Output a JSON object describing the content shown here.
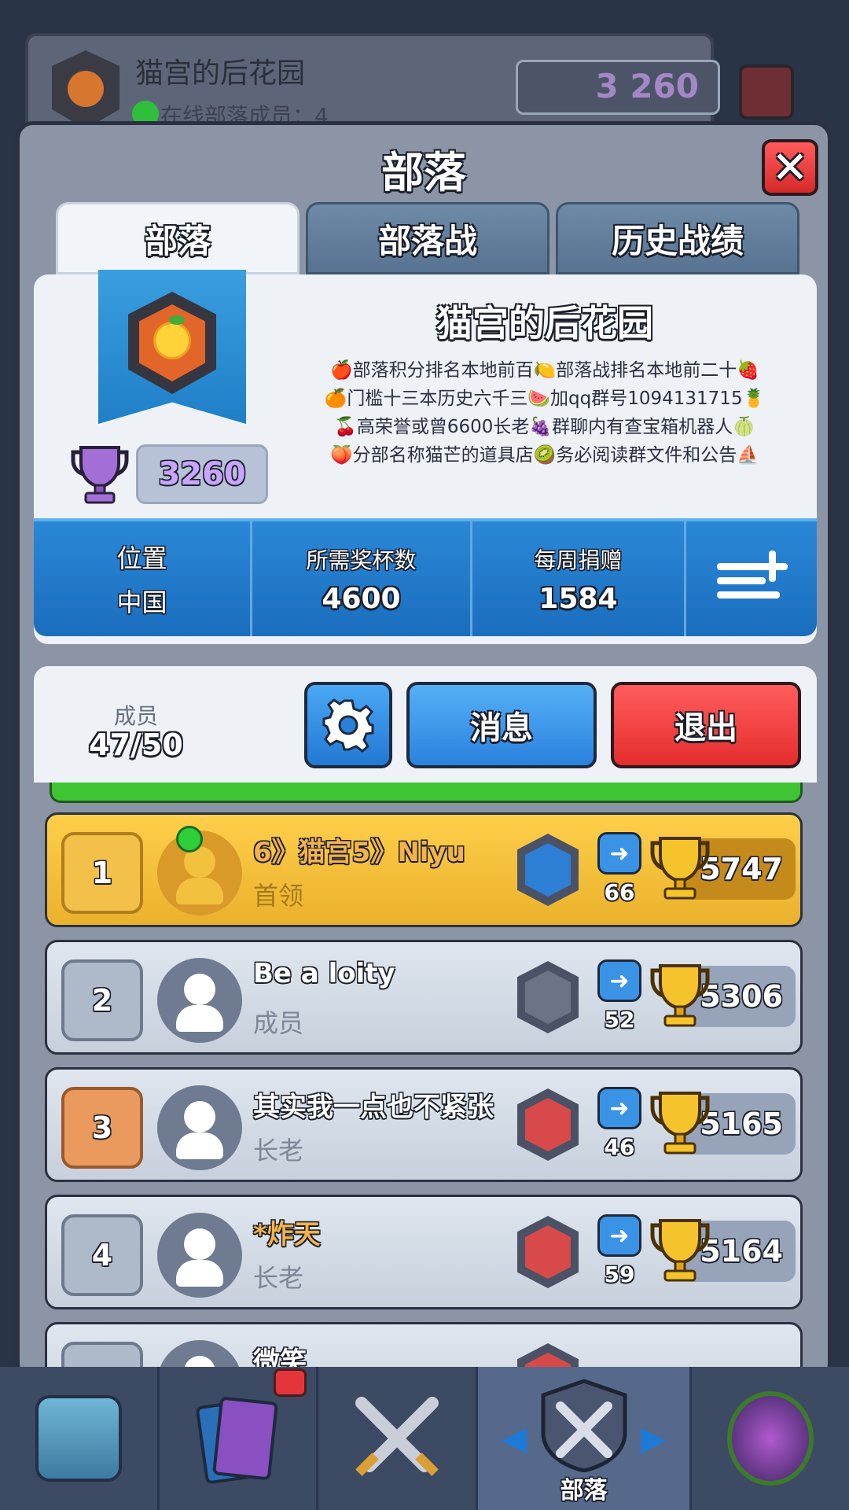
{
  "background": {
    "clan_name": "猫宫的后花园",
    "online_text": "在线部落成员：4",
    "trophies": "3 260"
  },
  "modal": {
    "title": "部落",
    "close_symbol": "✕",
    "tabs": [
      "部落",
      "部落战",
      "历史战绩"
    ],
    "active_tab": 0
  },
  "clan": {
    "name": "猫宫的后花园",
    "trophies": "3260",
    "description": [
      "🍎部落积分排名本地前百🍋部落战排名本地前二十🍓",
      "🍊门槛十三本历史六千三🍉加qq群号1094131715🍍",
      "🍒高荣誉或曾6600长老🍇群聊内有查宝箱机器人🍈",
      "🍑分部名称猫芒的道具店🥝务必阅读群文件和公告⛵"
    ],
    "stats": {
      "location_label": "位置",
      "location_value": "中国",
      "required_label": "所需奖杯数",
      "required_value": "4600",
      "donations_label": "每周捐赠",
      "donations_value": "1584"
    }
  },
  "members_panel": {
    "label": "成员",
    "count": "47/50",
    "message_button": "消息",
    "exit_button": "退出"
  },
  "members": [
    {
      "rank": "1",
      "name": "6》猫宫5》Niyu",
      "role": "首领",
      "donations": "66",
      "trophies": "5747",
      "online": true,
      "arena": "potion"
    },
    {
      "rank": "2",
      "name": "Be a loity",
      "role": "成员",
      "donations": "52",
      "trophies": "5306",
      "online": false,
      "arena": "hammer"
    },
    {
      "rank": "3",
      "name": "其实我一点也不紧张",
      "role": "长老",
      "donations": "46",
      "trophies": "5165",
      "online": false,
      "arena": "target"
    },
    {
      "rank": "4",
      "name": "*炸天",
      "role": "长老",
      "donations": "59",
      "trophies": "5164",
      "online": false,
      "arena": "target"
    },
    {
      "rank": "",
      "name": "微笑",
      "role": "",
      "donations": "",
      "trophies": "",
      "online": false,
      "arena": "target"
    }
  ],
  "bottom_nav": {
    "active_label": "部落",
    "cards_badge": "!"
  },
  "colors": {
    "accent_blue": "#2a88d6",
    "leader_gold": "#f3c04a",
    "exit_red": "#e52d2d",
    "online_green": "#2fcf3a"
  }
}
